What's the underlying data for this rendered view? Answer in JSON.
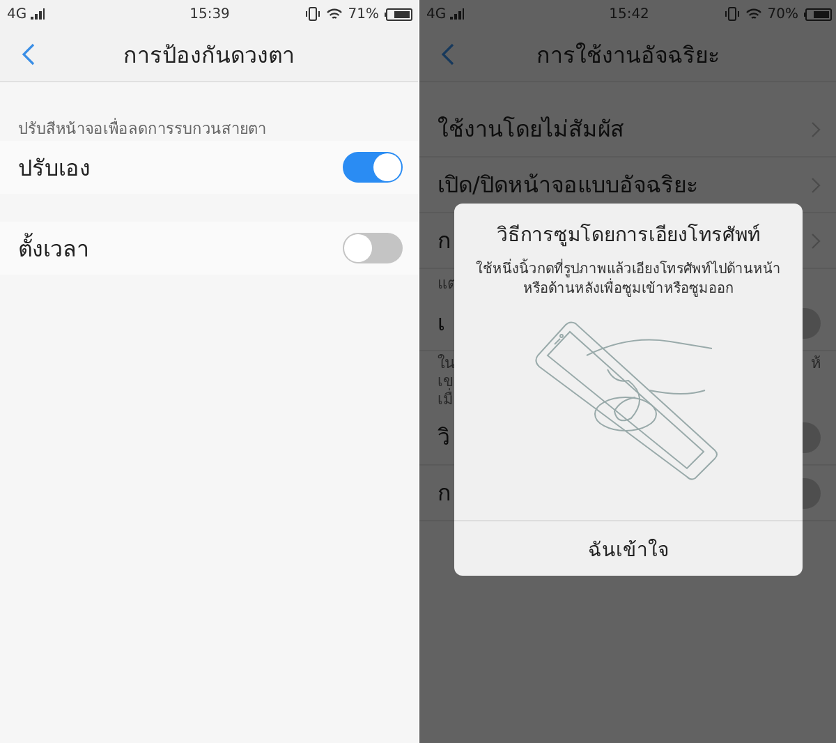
{
  "eye_protection_screen": {
    "status_bar": {
      "network": "4G",
      "time": "15:39",
      "battery": "71%"
    },
    "header": {
      "title": "การป้องกันดวงตา"
    },
    "section_caption": "ปรับสีหน้าจอเพื่อลดการรบกวนสายตา",
    "settings": [
      {
        "label": "ปรับเอง",
        "on": true
      },
      {
        "label": "ตั้งเวลา",
        "on": false
      }
    ]
  },
  "smart_usage_screen": {
    "status_bar": {
      "network": "4G",
      "time": "15:42",
      "battery": "70%"
    },
    "header": {
      "title": "การใช้งานอัจฉริยะ"
    },
    "rows": [
      {
        "kind": "link",
        "label": "ใช้งานโดยไม่สัมผัส"
      },
      {
        "kind": "link",
        "label": "เปิด/ปิดหน้าจอแบบอัจฉริยะ"
      },
      {
        "kind": "link",
        "label": "ก"
      },
      {
        "kind": "caption",
        "label": "แต"
      },
      {
        "kind": "toggle",
        "label": "เ",
        "on": false
      },
      {
        "kind": "note",
        "lines": [
          "ใน",
          "เข",
          "เมื่"
        ],
        "tail": "ห้"
      },
      {
        "kind": "toggle",
        "label": "วิ",
        "on": false
      },
      {
        "kind": "toggle",
        "label": "ก",
        "on": false
      }
    ],
    "dialog": {
      "title": "วิธีการซูมโดยการเอียงโทรศัพท์",
      "message": "ใช้หนึ่งนิ้วกดที่รูปภาพแล้วเอียงโทรศัพท์ไปด้านหน้า\nหรือด้านหลังเพื่อซูมเข้าหรือซูมออก",
      "button": "ฉันเข้าใจ"
    }
  }
}
